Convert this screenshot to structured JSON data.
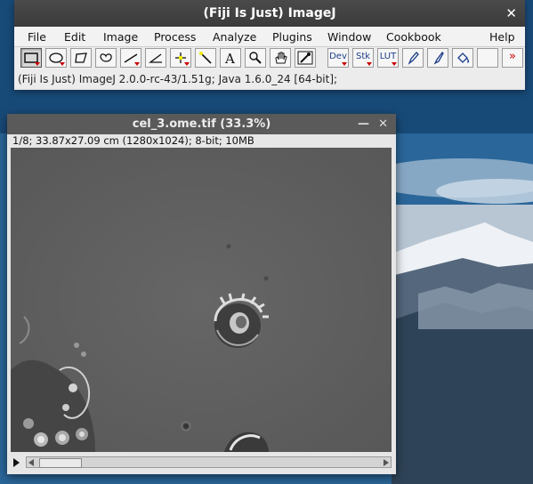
{
  "imagej": {
    "title": "(Fiji Is Just) ImageJ",
    "menus": [
      "File",
      "Edit",
      "Image",
      "Process",
      "Analyze",
      "Plugins",
      "Window",
      "Cookbook",
      "Help"
    ],
    "toolbar": {
      "dev_label": "Dev",
      "stk_label": "Stk",
      "lut_label": "LUT",
      "more_label": "»"
    },
    "status": "(Fiji Is Just) ImageJ 2.0.0-rc-43/1.51g; Java 1.6.0_24 [64-bit];"
  },
  "image_window": {
    "title": "cel_3.ome.tif (33.3%)",
    "info": "1/8; 33.87x27.09 cm (1280x1024); 8-bit; 10MB"
  },
  "colors": {
    "titlebar": "#3b3b3b",
    "accent_red": "#cc0000",
    "image_gray": "#5e5e5e"
  }
}
